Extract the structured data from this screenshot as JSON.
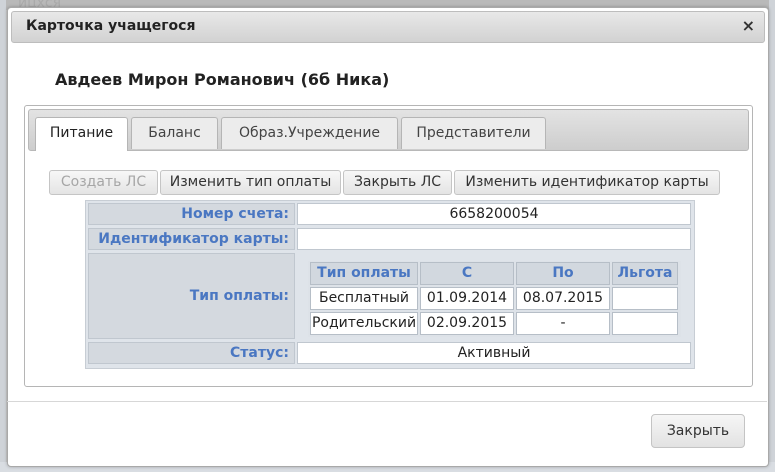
{
  "background": {
    "peek_text": "ицхся"
  },
  "dialog": {
    "title": "Карточка учащегося",
    "close_glyph": "×",
    "student_name": "Авдеев Мирон Романович (6б Ника)",
    "tabs": [
      {
        "label": "Питание",
        "active": true
      },
      {
        "label": "Баланс",
        "active": false
      },
      {
        "label": "Образ.Учреждение",
        "active": false
      },
      {
        "label": "Представители",
        "active": false
      }
    ],
    "toolbar": {
      "create_account": "Создать ЛС",
      "change_payment_type": "Изменить тип оплаты",
      "close_account": "Закрыть ЛС",
      "change_card_id": "Изменить идентификатор карты"
    },
    "account": {
      "number_label": "Номер счета:",
      "number_value": "6658200054",
      "card_id_label": "Идентификатор карты:",
      "card_id_value": "",
      "payment_type_label": "Тип оплаты:",
      "status_label": "Статус:",
      "status_value": "Активный"
    },
    "payment_table": {
      "headers": [
        "Тип оплаты",
        "С",
        "По",
        "Льгота"
      ],
      "rows": [
        [
          "Бесплатный",
          "01.09.2014",
          "08.07.2015",
          ""
        ],
        [
          "Родительский",
          "02.09.2015",
          "-",
          ""
        ]
      ]
    },
    "footer": {
      "close_label": "Закрыть"
    }
  },
  "colors": {
    "label_blue": "#4a77c2",
    "titlebar": "#dcdcdc",
    "table_bg": "#dfe4ea"
  }
}
